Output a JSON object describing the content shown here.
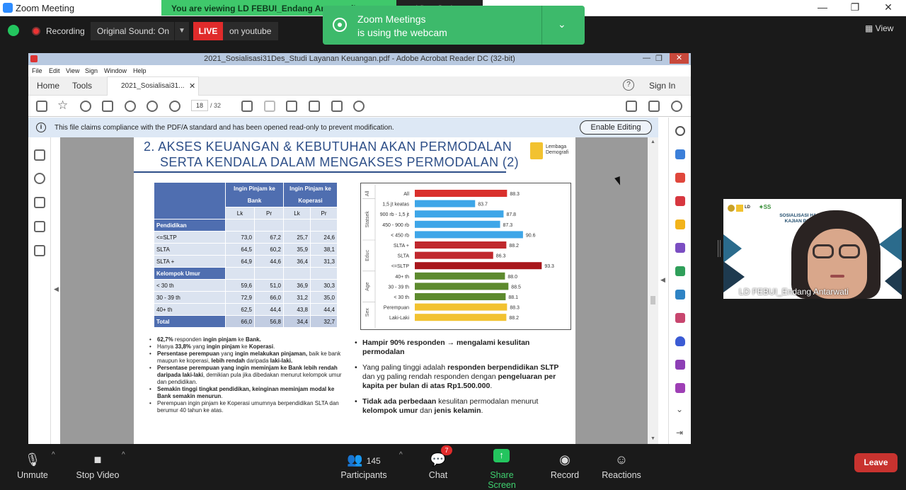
{
  "window": {
    "title": "Zoom Meeting"
  },
  "banner_top": {
    "viewing": "You are viewing LD FEBUI_Endang Antarwati's screen",
    "view_options": "View Options"
  },
  "meeting_bar": {
    "recording": "Recording",
    "original_sound": "Original Sound: On",
    "live_label": "LIVE",
    "live_target": "on youtube",
    "view_label": "View"
  },
  "notification": {
    "line1": "Zoom Meetings",
    "line2": "is using the webcam"
  },
  "acrobat": {
    "title": "2021_Sosialisasi31Des_Studi Layanan Keuangan.pdf - Adobe Acrobat Reader DC (32-bit)",
    "menu": [
      "File",
      "Edit",
      "View",
      "Sign",
      "Window",
      "Help"
    ],
    "tabs": {
      "home": "Home",
      "tools": "Tools",
      "doc": "2021_Sosialisai31...",
      "sign_in": "Sign In",
      "help": "?"
    },
    "page_current": "18",
    "page_total": "/ 32",
    "pdfa_message": "This file claims compliance with the PDF/A standard and has been opened read-only to prevent modification.",
    "enable_editing": "Enable Editing"
  },
  "slide": {
    "title_line1": "2. AKSES KEUANGAN & KEBUTUHAN AKAN PERMODALAN",
    "title_line2": "SERTA KENDALA DALAM MENGAKSES PERMODALAN (2)",
    "logo_text": "Lembaga Demografi",
    "table": {
      "head_bank": "Ingin Pinjam ke Bank",
      "head_kop": "Ingin Pinjam ke Koperasi",
      "sub": [
        "Lk",
        "Pr",
        "Lk",
        "Pr"
      ],
      "rows": [
        {
          "label": "Pendidikan",
          "type": "section"
        },
        {
          "label": "<=SLTP",
          "values": [
            "73,0",
            "67,2",
            "25,7",
            "24,6"
          ]
        },
        {
          "label": "SLTA",
          "values": [
            "64,5",
            "60,2",
            "35,9",
            "38,1"
          ]
        },
        {
          "label": "SLTA +",
          "values": [
            "64,9",
            "44,6",
            "36,4",
            "31,3"
          ]
        },
        {
          "label": "Kelompok Umur",
          "type": "section"
        },
        {
          "label": "< 30 th",
          "values": [
            "59,6",
            "51,0",
            "36,9",
            "30,3"
          ]
        },
        {
          "label": "30 - 39 th",
          "values": [
            "72,9",
            "66,0",
            "31,2",
            "35,0"
          ]
        },
        {
          "label": "40+ th",
          "values": [
            "62,5",
            "44,4",
            "43,8",
            "44,4"
          ]
        },
        {
          "label": "Total",
          "type": "total",
          "values": [
            "66,0",
            "56,8",
            "34,4",
            "32,7"
          ]
        }
      ]
    },
    "left_notes": [
      [
        [
          "b",
          "62,7%"
        ],
        [
          "n",
          " responden "
        ],
        [
          "b",
          "ingin pinjam"
        ],
        [
          "n",
          " ke "
        ],
        [
          "b",
          "Bank."
        ]
      ],
      [
        [
          "n",
          "Hanya "
        ],
        [
          "b",
          "33,8%"
        ],
        [
          "n",
          " yang "
        ],
        [
          "b",
          "ingin pinjam"
        ],
        [
          "n",
          " ke "
        ],
        [
          "b",
          "Koperasi"
        ],
        [
          "n",
          "."
        ]
      ],
      [
        [
          "b",
          "Persentase perempuan"
        ],
        [
          "n",
          " yang "
        ],
        [
          "b",
          "ingin melakukan pinjaman,"
        ],
        [
          "n",
          " baik ke bank maupun ke koperasi, "
        ],
        [
          "b",
          "lebih rendah"
        ],
        [
          "n",
          " daripada "
        ],
        [
          "b",
          "laki-laki."
        ]
      ],
      [
        [
          "b",
          "Persentase perempuan yang ingin meminjam ke Bank lebih rendah daripada laki-laki"
        ],
        [
          "n",
          ", demikian pula jika dibedakan menurut kelompok umur dan pendidikan."
        ]
      ],
      [
        [
          "b",
          "Semakin tinggi tingkat pendidikan, keinginan meminjam modal ke Bank semakin menurun"
        ],
        [
          "n",
          "."
        ]
      ],
      [
        [
          "n",
          "Perempuan ingin pinjam ke Koperasi umumnya berpendidikan SLTA dan berumur 40 tahun ke atas."
        ]
      ]
    ],
    "right_notes": [
      [
        [
          "b",
          "Hampir 90% responden → mengalami kesulitan permodalan"
        ]
      ],
      [
        [
          "n",
          "Yang paling tinggi adalah "
        ],
        [
          "b",
          "responden berpendidikan SLTP"
        ],
        [
          "n",
          " dan yg paling rendah responden dengan "
        ],
        [
          "b",
          "pengeluaran per kapita per bulan di atas Rp1.500.000"
        ],
        [
          "n",
          "."
        ]
      ],
      [
        [
          "b",
          "Tidak ada perbedaan"
        ],
        [
          "n",
          " kesulitan permodalan menurut "
        ],
        [
          "b",
          "kelompok umur"
        ],
        [
          "n",
          " dan "
        ],
        [
          "b",
          "jenis kelamin"
        ],
        [
          "n",
          "."
        ]
      ]
    ]
  },
  "chart_data": {
    "type": "bar",
    "orientation": "horizontal",
    "categories": [
      "All",
      "1,5 jt keatas",
      "900 rb - 1,5 jt",
      "450 - 900 rb",
      "< 450 rb",
      "SLTA +",
      "SLTA",
      "<=SLTP",
      "40+ th",
      "30 - 39 th",
      "< 30 th",
      "Perempuan",
      "Laki-Laki"
    ],
    "values": [
      88.3,
      83.7,
      87.8,
      87.3,
      90.6,
      88.2,
      86.3,
      93.3,
      88.0,
      88.5,
      88.1,
      88.3,
      88.2
    ],
    "value_labels": [
      "88.3",
      "83.7",
      "87.8",
      "87.3",
      "90.6",
      "88.2",
      "86.3",
      "93.3",
      "88.0",
      "88.5",
      "88.1",
      "88.3",
      "88.2"
    ],
    "groups": [
      {
        "name": "All",
        "start": 0,
        "count": 1
      },
      {
        "name": "Statsek",
        "start": 1,
        "count": 4
      },
      {
        "name": "Educ",
        "start": 5,
        "count": 3
      },
      {
        "name": "Age",
        "start": 8,
        "count": 3
      },
      {
        "name": "Sex",
        "start": 11,
        "count": 2
      }
    ],
    "colors": [
      "#d9302c",
      "#3ea6e8",
      "#3ea6e8",
      "#3ea6e8",
      "#3ea6e8",
      "#c0282d",
      "#c0282d",
      "#a8171c",
      "#5d8a2e",
      "#5d8a2e",
      "#5d8a2e",
      "#f2c230",
      "#f2c230"
    ],
    "xlim": [
      75,
      95
    ]
  },
  "participant_video": {
    "name": "LD FEBUI_Endang Antarwati",
    "slide_text": "SOSIALISASI HASIL STUDI DAN KAJIAN PADA PR... TAHU..."
  },
  "bottom_bar": {
    "unmute": "Unmute",
    "stop_video": "Stop Video",
    "participants": "Participants",
    "participant_count": "145",
    "chat": "Chat",
    "chat_badge": "7",
    "share_screen": "Share Screen",
    "record": "Record",
    "reactions": "Reactions",
    "leave": "Leave"
  },
  "colors": {
    "zoom_green": "#3dba6b",
    "live_red": "#e02b2b",
    "leave_red": "#c8332f",
    "acrobat_blue": "#2e4f88"
  }
}
